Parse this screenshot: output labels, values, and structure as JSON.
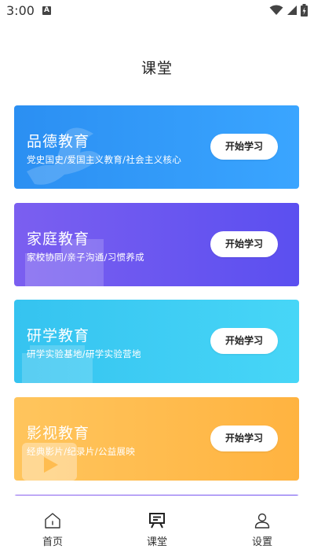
{
  "status_bar": {
    "time": "3:00",
    "notification_letter": "A"
  },
  "page": {
    "title": "课堂"
  },
  "cards": [
    {
      "title": "品德教育",
      "subtitle": "党史国史/爱国主义教育/社会主义核心",
      "button": "开始学习",
      "color": "#2b8ff2"
    },
    {
      "title": "家庭教育",
      "subtitle": "家校协同/亲子沟通/习惯养成",
      "button": "开始学习",
      "color": "#6a57f0"
    },
    {
      "title": "研学教育",
      "subtitle": "研学实验基地/研学实验营地",
      "button": "开始学习",
      "color": "#3cc8f2"
    },
    {
      "title": "影视教育",
      "subtitle": "经典影片/纪录片/公益展映",
      "button": "开始学习",
      "color": "#ffbd4f"
    }
  ],
  "bottom_nav": {
    "items": [
      {
        "label": "首页",
        "icon": "home-icon",
        "active": false
      },
      {
        "label": "课堂",
        "icon": "classroom-icon",
        "active": true
      },
      {
        "label": "设置",
        "icon": "user-icon",
        "active": false
      }
    ]
  }
}
